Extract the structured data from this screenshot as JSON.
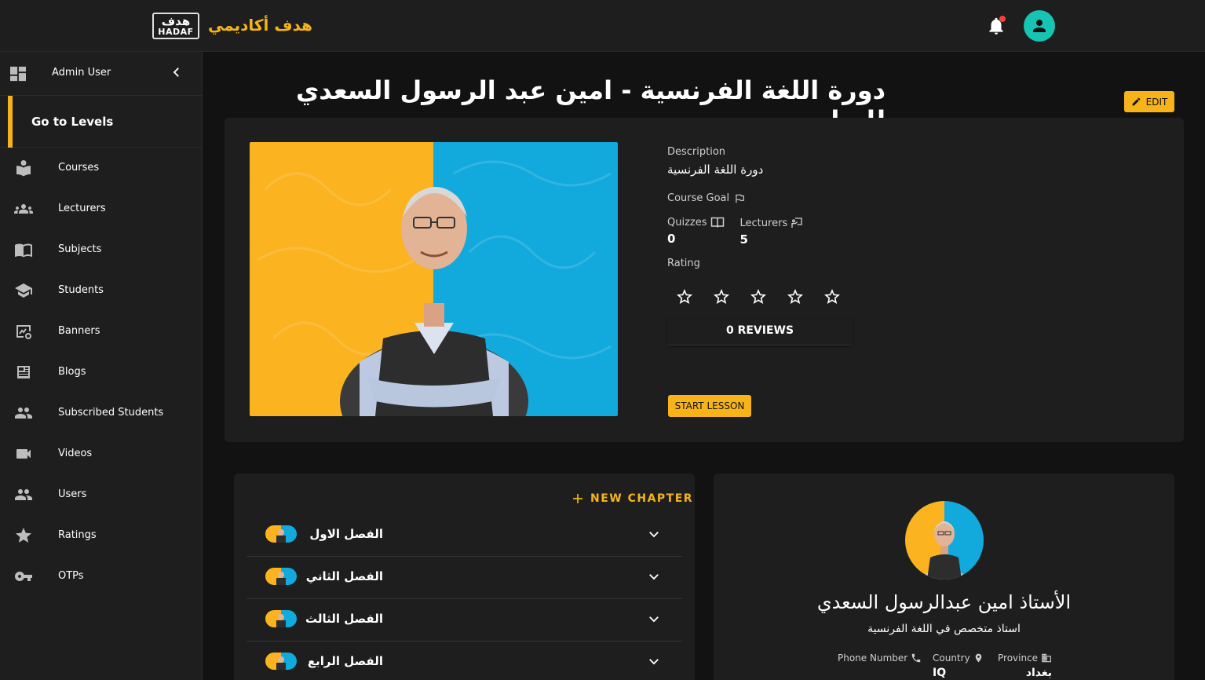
{
  "brand": {
    "logo_ar": "هدف",
    "logo_en": "HADAF",
    "name": "هدف أكاديمي"
  },
  "sidebar": {
    "user": "Admin User",
    "levels_label": "Go to Levels",
    "items": [
      {
        "label": "Courses",
        "icon": "course-icon"
      },
      {
        "label": "Lecturers",
        "icon": "group-icon"
      },
      {
        "label": "Subjects",
        "icon": "book-icon"
      },
      {
        "label": "Students",
        "icon": "school-icon"
      },
      {
        "label": "Banners",
        "icon": "banner-icon"
      },
      {
        "label": "Blogs",
        "icon": "newspaper-icon"
      },
      {
        "label": "Subscribed Students",
        "icon": "people-icon"
      },
      {
        "label": "Videos",
        "icon": "videocam-icon"
      },
      {
        "label": "Users",
        "icon": "users-icon"
      },
      {
        "label": "Ratings",
        "icon": "star-icon"
      },
      {
        "label": "OTPs",
        "icon": "key-icon"
      }
    ]
  },
  "course": {
    "title": "دورة اللغة الفرنسية - امين عبد الرسول السعدي للسادس",
    "edit_label": "EDIT",
    "description_label": "Description",
    "description": "دورة اللغة الفرنسية",
    "goal_label": "Course Goal",
    "quizzes_label": "Quizzes",
    "quizzes": "0",
    "lecturers_label": "Lecturers",
    "lecturers": "5",
    "rating_label": "Rating",
    "rating": 0,
    "reviews": "0 REVIEWS",
    "start_label": "START LESSON"
  },
  "chapters": {
    "new_label": "NEW CHAPTER",
    "items": [
      "الفصل الاول",
      "الفصل الثاني",
      "الفصل الثالث",
      "الفصل الرابع"
    ]
  },
  "lecturer": {
    "name": "الأستاذ امين عبدالرسول السعدي",
    "bio": "استاذ متخصص في اللغة الفرنسية",
    "phone_label": "Phone Number",
    "country_label": "Country",
    "country": "IQ",
    "province_label": "Province",
    "province": "بغداد"
  },
  "colors": {
    "accent": "#f6b41a",
    "avatar": "#17c4b3",
    "panel": "#1e1e1e",
    "background": "#121212"
  }
}
